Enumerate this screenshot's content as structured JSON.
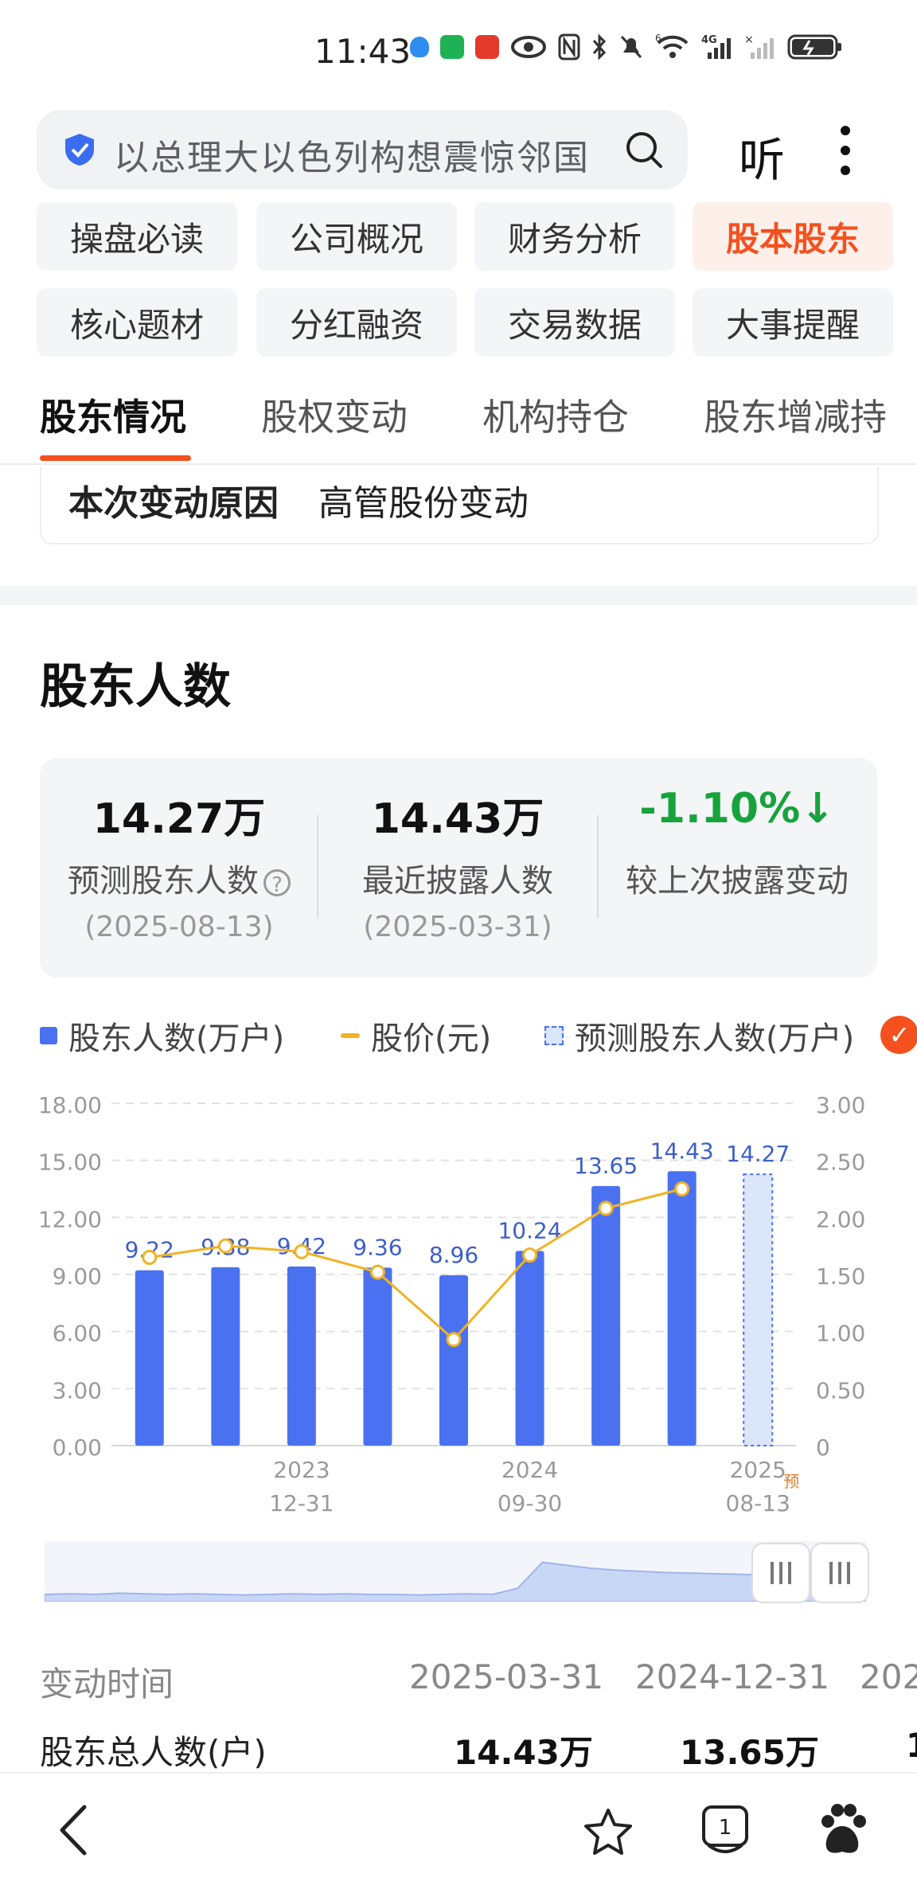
{
  "status_bar": {
    "time": "11:43",
    "icons": [
      "shield-status-icon",
      "wechat-icon",
      "app-icon",
      "eye-icon",
      "nfc-icon",
      "bluetooth-icon",
      "mute-icon",
      "wifi-icon",
      "signal-4g-icon",
      "signal-icon",
      "battery-charging-icon"
    ],
    "network": "4G",
    "wifi_badge": "6"
  },
  "search": {
    "placeholder": "以总理大以色列构想震惊邻国",
    "listen_label": "听"
  },
  "nav_grid": {
    "items": [
      "操盘必读",
      "公司概况",
      "财务分析",
      "股本股东",
      "核心题材",
      "分红融资",
      "交易数据",
      "大事提醒"
    ],
    "active_index": 3
  },
  "tabs": {
    "items": [
      "股东情况",
      "股权变动",
      "机构持仓",
      "股东增减持"
    ],
    "active_index": 0
  },
  "reason": {
    "label": "本次变动原因",
    "value": "高管股份变动"
  },
  "section": {
    "title": "股东人数"
  },
  "stats": {
    "predicted": {
      "value": "14.27万",
      "label": "预测股东人数",
      "date": "(2025-08-13)",
      "help": "?"
    },
    "latest": {
      "value": "14.43万",
      "label": "最近披露人数",
      "date": "(2025-03-31)"
    },
    "change": {
      "value": "-1.10%",
      "label": "较上次披露变动"
    }
  },
  "legend": {
    "items": [
      "股东人数(万户)",
      "股价(元)",
      "预测股东人数(万户)"
    ],
    "check": "✓"
  },
  "colors": {
    "accent": "#f4511e",
    "bar": "#4a72f0",
    "line": "#f0b323",
    "down": "#17a33c"
  },
  "chart_data": {
    "type": "bar",
    "left_axis": {
      "ticks": [
        "18.00",
        "15.00",
        "12.00",
        "9.00",
        "6.00",
        "3.00",
        "0.00"
      ],
      "range": [
        0,
        18
      ]
    },
    "right_axis": {
      "ticks": [
        "3.00",
        "2.50",
        "2.00",
        "1.50",
        "1.00",
        "0.50",
        "0"
      ],
      "range": [
        0,
        3
      ]
    },
    "x_labels": [
      {
        "index": 2,
        "line1": "2023",
        "line2": "12-31"
      },
      {
        "index": 5,
        "line1": "2024",
        "line2": "09-30"
      },
      {
        "index": 8,
        "line1": "2025",
        "line2": "08-13"
      }
    ],
    "predict_tag": "预",
    "series": [
      {
        "name": "股东人数(万户)",
        "type": "bar",
        "values": [
          9.22,
          9.38,
          9.42,
          9.36,
          8.96,
          10.24,
          13.65,
          14.43,
          null
        ],
        "labels": [
          "9.22",
          "9.38",
          "9.42",
          "9.36",
          "8.96",
          "10.24",
          "13.65",
          "14.43",
          ""
        ]
      },
      {
        "name": "股价(元)",
        "type": "line",
        "values": [
          1.65,
          1.75,
          1.7,
          1.52,
          0.93,
          1.67,
          2.08,
          2.25,
          null
        ]
      },
      {
        "name": "预测股东人数(万户)",
        "type": "bar-dashed",
        "values": [
          null,
          null,
          null,
          null,
          null,
          null,
          null,
          null,
          14.27
        ],
        "labels": [
          "",
          "",
          "",
          "",
          "",
          "",
          "",
          "",
          "14.27"
        ]
      }
    ],
    "grid": true
  },
  "navigator": {
    "values": [
      0.12,
      0.13,
      0.12,
      0.14,
      0.13,
      0.12,
      0.13,
      0.12,
      0.11,
      0.12,
      0.13,
      0.12,
      0.13,
      0.12,
      0.12,
      0.11,
      0.12,
      0.13,
      0.12,
      0.22,
      0.65,
      0.6,
      0.55,
      0.52,
      0.5,
      0.48,
      0.47,
      0.46,
      0.45,
      0.44,
      0.43,
      0.42,
      0.42,
      0.41
    ]
  },
  "table": {
    "header": {
      "label": "变动时间",
      "cols": [
        "2025-03-31",
        "2024-12-31",
        "202"
      ]
    },
    "rows": [
      {
        "label": "股东总人数(户)",
        "cols": [
          "14.43万",
          "13.65万",
          "1"
        ]
      }
    ]
  },
  "bottom_bar": {
    "back": "back-icon",
    "star": "star-icon",
    "tabs_count": "1",
    "baidu": "baidu-paw-icon"
  }
}
